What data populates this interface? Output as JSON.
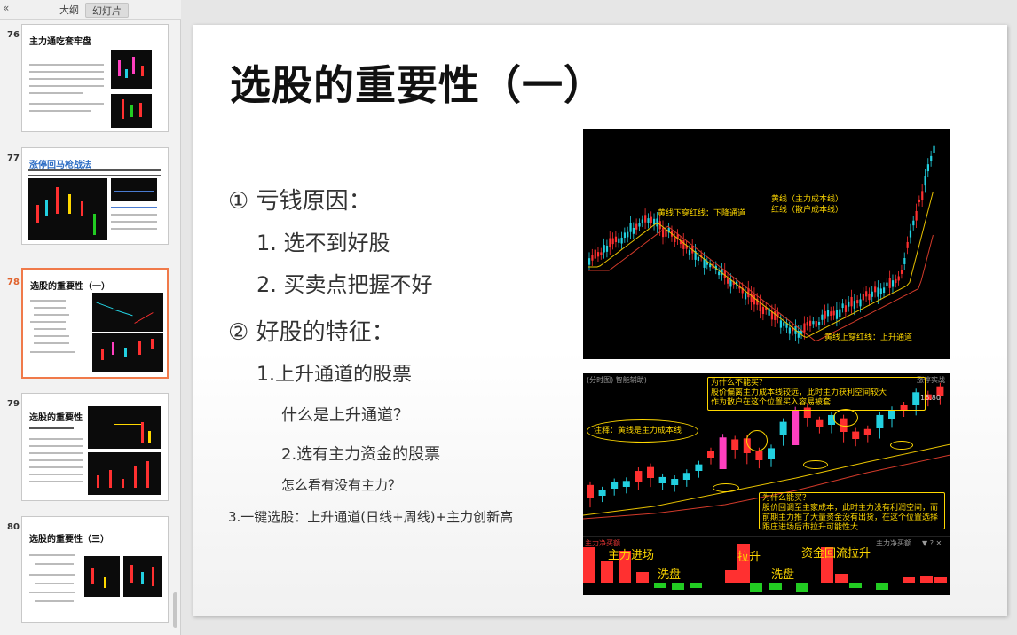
{
  "panel": {
    "collapse_icon": "«",
    "tabs": [
      "大纲",
      "幻灯片"
    ],
    "active_tab": "幻灯片"
  },
  "thumbnails": [
    {
      "num": "76",
      "title": "主力通吃套牢盘"
    },
    {
      "num": "77",
      "title": "涨停回马枪战法"
    },
    {
      "num": "78",
      "title": "选股的重要性（一）",
      "selected": true
    },
    {
      "num": "79",
      "title": "选股的重要性（二）"
    },
    {
      "num": "80",
      "title": "选股的重要性（三）"
    }
  ],
  "slide": {
    "title": "选股的重要性（一）",
    "items": [
      "① 亏钱原因：",
      "1.  选不到好股",
      "2.  买卖点把握不好",
      "② 好股的特征：",
      "1.上升通道的股票",
      "什么是上升通道？",
      "2.选有主力资金的股票",
      "怎么看有没有主力？",
      "3.一键选股：上升通道(日线+周线)+主力创新高"
    ],
    "chart_top": {
      "legend_line1": "黄线（主力成本线）",
      "legend_line2": "红线（散户成本线）",
      "anno_down": "黄线下穿红线：下降通道",
      "anno_up": "黄线上穿红线：上升通道"
    },
    "chart_bottom": {
      "header_left": "(分时图) 智能辅助)",
      "header_right": "涨停实战",
      "price_tag": "16.80",
      "anno_note": "注释：黄线是主力成本线",
      "why_not_buy": "为什么不能买？\n股价偏离主力成本线较远，此时主力获利空间较大\n作为散户在这个位置买入容易被套",
      "why_buy": "为什么能买？\n股价回调至主家成本，此时主力没有利润空间，而前期主力推了大量资金没有出货，在这个位置选择跟庄进场后市拉升可能性大",
      "sub_label_left": "主力净买额",
      "sub_label_right": "主力净买额",
      "sub_icons": "▼ ? ✕",
      "labels": [
        "主力进场",
        "洗盘",
        "拉升",
        "洗盘",
        "资金回流拉升"
      ]
    }
  },
  "colors": {
    "accent_selected": "#f07a4a",
    "candle_up": "#ff3030",
    "candle_down": "#22d0e0",
    "line_yellow": "#e8c200",
    "line_red": "#d23a2a",
    "annotation": "#ffd800",
    "volume_green": "#22cc22"
  }
}
